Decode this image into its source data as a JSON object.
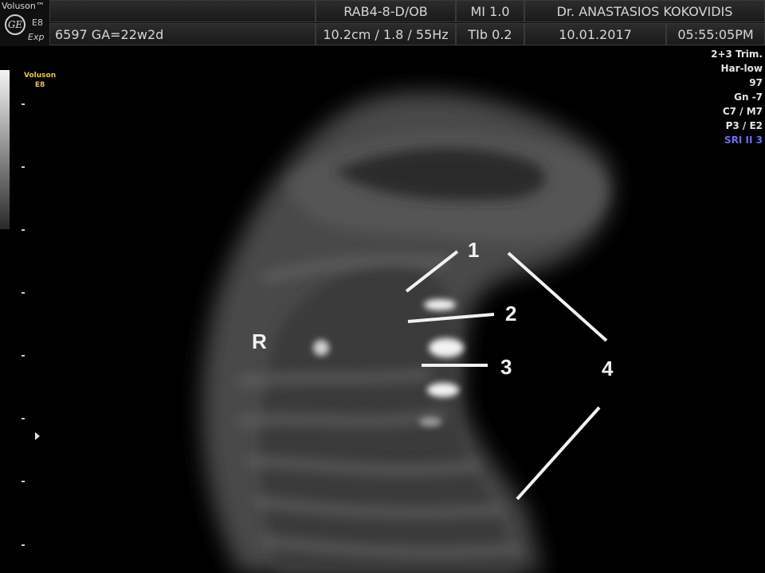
{
  "header": {
    "brand": "Voluson™",
    "model_short": "E8",
    "mode_short": "Exp",
    "patient": "6597  GA=22w2d",
    "probe": "RAB4-8-D/OB",
    "depth_info": "10.2cm / 1.8 / 55Hz",
    "mi": "MI  1.0",
    "tib": "TIb  0.2",
    "doctor": "Dr. ANASTASIOS KOKOVIDIS",
    "date": "10.01.2017",
    "time": "05:55:05PM"
  },
  "side_logo": {
    "line1": "Voluson",
    "line2": "E8"
  },
  "params": [
    "2+3 Trim.",
    "Har-low",
    "97",
    "Gn  -7",
    "C7 / M7",
    "P3 / E2",
    "SRI II 3"
  ],
  "annotations": {
    "r": "R",
    "n1": "1",
    "n2": "2",
    "n3": "3",
    "n4": "4"
  },
  "colors": {
    "highlight_param": "#6d6dff",
    "logo_accent": "#e6c84a"
  }
}
